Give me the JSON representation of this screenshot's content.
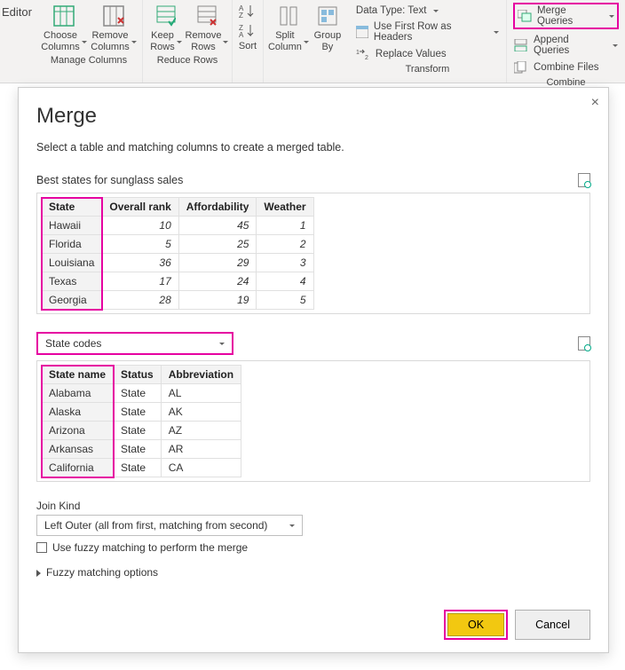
{
  "ribbon": {
    "editor_label": "Editor",
    "groups": {
      "manage_columns": {
        "label": "Manage Columns",
        "choose": "Choose\nColumns",
        "remove": "Remove\nColumns"
      },
      "reduce_rows": {
        "label": "Reduce Rows",
        "keep": "Keep\nRows",
        "remove": "Remove\nRows"
      },
      "sort": {
        "label": "Sort"
      },
      "transform1": {
        "split": "Split\nColumn",
        "group": "Group\nBy"
      },
      "transform2": {
        "label": "Transform",
        "datatype": "Data Type: Text",
        "first_row": "Use First Row as Headers",
        "replace": "Replace Values"
      },
      "combine": {
        "label": "Combine",
        "merge": "Merge Queries",
        "append": "Append Queries",
        "combine_files": "Combine Files"
      }
    }
  },
  "dialog": {
    "title": "Merge",
    "desc": "Select a table and matching columns to create a merged table.",
    "table1_name": "Best states for sunglass sales",
    "table1": {
      "cols": [
        "State",
        "Overall rank",
        "Affordability",
        "Weather"
      ],
      "rows": [
        [
          "Hawaii",
          "10",
          "45",
          "1"
        ],
        [
          "Florida",
          "5",
          "25",
          "2"
        ],
        [
          "Louisiana",
          "36",
          "29",
          "3"
        ],
        [
          "Texas",
          "17",
          "24",
          "4"
        ],
        [
          "Georgia",
          "28",
          "19",
          "5"
        ]
      ]
    },
    "table2_picker": "State codes",
    "table2": {
      "cols": [
        "State name",
        "Status",
        "Abbreviation"
      ],
      "rows": [
        [
          "Alabama",
          "State",
          "AL"
        ],
        [
          "Alaska",
          "State",
          "AK"
        ],
        [
          "Arizona",
          "State",
          "AZ"
        ],
        [
          "Arkansas",
          "State",
          "AR"
        ],
        [
          "California",
          "State",
          "CA"
        ]
      ]
    },
    "join_kind_label": "Join Kind",
    "join_kind_value": "Left Outer (all from first, matching from second)",
    "fuzzy_checkbox": "Use fuzzy matching to perform the merge",
    "fuzzy_expander": "Fuzzy matching options",
    "ok": "OK",
    "cancel": "Cancel"
  }
}
